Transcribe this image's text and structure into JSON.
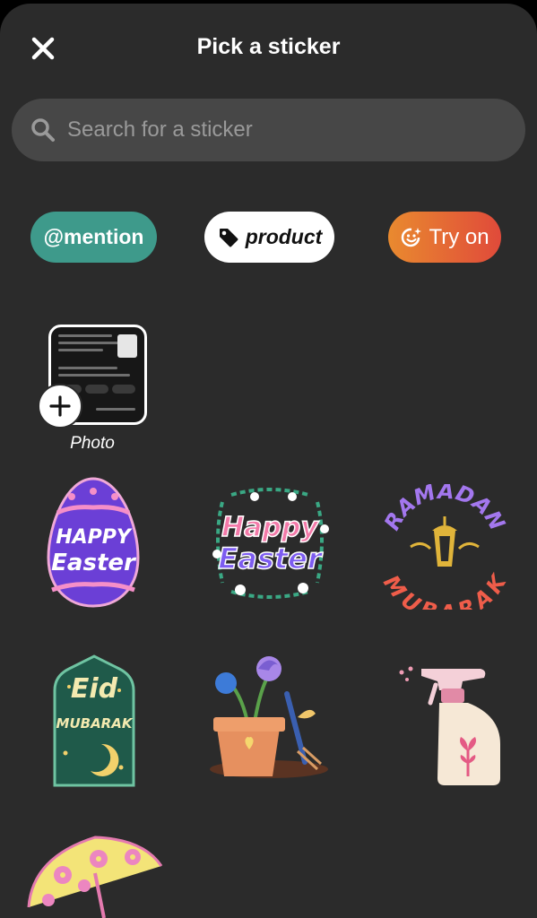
{
  "header": {
    "title": "Pick a sticker"
  },
  "search": {
    "placeholder": "Search for a sticker"
  },
  "chips": {
    "mention": "@mention",
    "product": "product",
    "try_on": "Try on"
  },
  "photo": {
    "label": "Photo"
  },
  "stickers": {
    "easter_egg": {
      "line1": "HAPPY",
      "line2": "Easter"
    },
    "easter_floral": {
      "line1": "Happy",
      "line2": "Easter"
    },
    "ramadan": {
      "line1": "RAMADAN",
      "line2": "MUBARAK"
    },
    "eid": {
      "line1": "Eid",
      "line2": "MUBARAK"
    }
  }
}
